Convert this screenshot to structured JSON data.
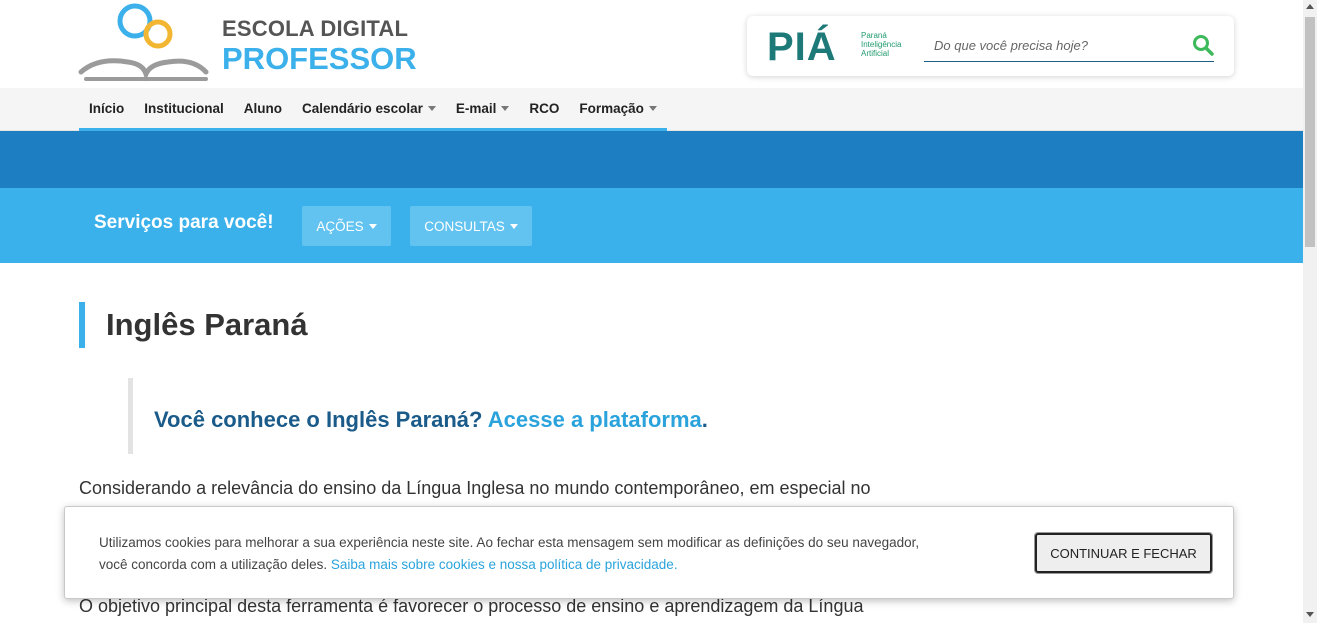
{
  "header": {
    "logo": {
      "line1": "ESCOLA DIGITAL",
      "line2": "PROFESSOR",
      "icon": "open-book-rings-logo"
    },
    "pia": {
      "word": "PIÁ",
      "sub_line1": "Paraná",
      "sub_line2": "Inteligência",
      "sub_line3": "Artificial"
    },
    "search": {
      "placeholder": "Do que você precisa hoje?",
      "icon": "search-icon"
    }
  },
  "nav": {
    "items": [
      {
        "label": "Início",
        "dropdown": false
      },
      {
        "label": "Institucional",
        "dropdown": false
      },
      {
        "label": "Aluno",
        "dropdown": false
      },
      {
        "label": "Calendário escolar",
        "dropdown": true
      },
      {
        "label": "E-mail",
        "dropdown": true
      },
      {
        "label": "RCO",
        "dropdown": false
      },
      {
        "label": "Formação",
        "dropdown": true
      }
    ]
  },
  "services": {
    "title": "Serviços para você!",
    "buttons": [
      {
        "label": "AÇÕES"
      },
      {
        "label": "CONSULTAS"
      }
    ]
  },
  "content": {
    "title": "Inglês Paraná",
    "quote_text": "Você conhece o Inglês Paraná? ",
    "quote_link": "Acesse a plataforma",
    "quote_end": ".",
    "paragraph1": "Considerando a relevância do ensino da Língua Inglesa no mundo contemporâneo, em especial no",
    "paragraph2": "O objetivo principal desta ferramenta é favorecer o processo de ensino e aprendizagem da Língua"
  },
  "cookie": {
    "text_line1": "Utilizamos cookies para melhorar a sua experiência neste site. Ao fechar esta mensagem sem modificar as definições do seu navegador,",
    "text_line2": "você concorda com a utilização deles. ",
    "link": "Saiba mais sobre cookies e nossa política de privacidade.",
    "button": "CONTINUAR E FECHAR"
  },
  "colors": {
    "accent": "#3bb0ea",
    "dark_band": "#1d7fc1",
    "light_band": "#3ab1eb",
    "quote_text": "#1b5b8a",
    "link": "#2aa3dc",
    "search_icon": "#3cb95a"
  }
}
